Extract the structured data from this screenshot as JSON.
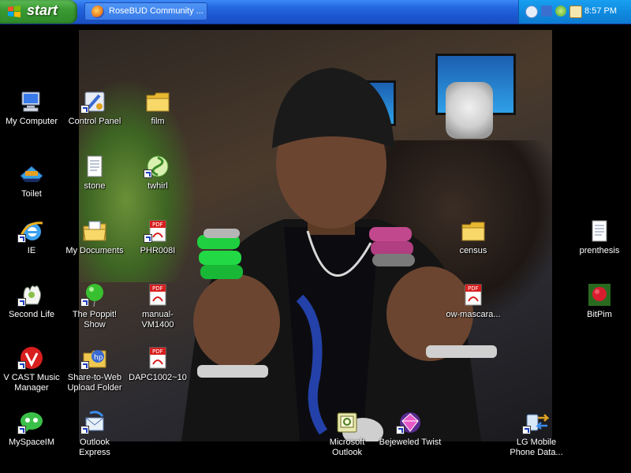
{
  "taskbar": {
    "start_label": "start",
    "tasks": [
      {
        "label": "RoseBUD Community ..."
      }
    ],
    "clock": "8:57 PM"
  },
  "desktop": {
    "icons": [
      {
        "label": "My Computer",
        "icon": "my-computer-icon"
      },
      {
        "label": "Control Panel",
        "icon": "control-panel-icon"
      },
      {
        "label": "film",
        "icon": "folder-icon"
      },
      {
        "label": "Toilet",
        "icon": "toilet-icon"
      },
      {
        "label": "stone",
        "icon": "text-document-icon"
      },
      {
        "label": "twhirl",
        "icon": "twhirl-icon"
      },
      {
        "label": "IE",
        "icon": "internet-explorer-icon"
      },
      {
        "label": "My Documents",
        "icon": "my-documents-icon"
      },
      {
        "label": "PHR008I",
        "icon": "pdf-icon"
      },
      {
        "label": "census",
        "icon": "folder-icon"
      },
      {
        "label": "prenthesis",
        "icon": "text-document-icon"
      },
      {
        "label": "Second Life",
        "icon": "second-life-icon"
      },
      {
        "label": "The Poppit! Show",
        "icon": "poppit-icon"
      },
      {
        "label": "manual-VM1400",
        "icon": "pdf-icon"
      },
      {
        "label": "ow-mascara...",
        "icon": "pdf-icon"
      },
      {
        "label": "BitPim",
        "icon": "bitpim-icon"
      },
      {
        "label": "V CAST Music Manager",
        "icon": "vcast-icon"
      },
      {
        "label": "Share-to-Web Upload Folder",
        "icon": "hp-share-icon"
      },
      {
        "label": "DAPC1002~10",
        "icon": "pdf-icon"
      },
      {
        "label": "MySpaceIM",
        "icon": "myspaceim-icon"
      },
      {
        "label": "Outlook Express",
        "icon": "outlook-express-icon"
      },
      {
        "label": "Microsoft Outlook",
        "icon": "outlook-icon"
      },
      {
        "label": "Bejeweled Twist",
        "icon": "bejeweled-icon"
      },
      {
        "label": "LG Mobile Phone Data...",
        "icon": "lg-mobile-icon"
      }
    ]
  }
}
